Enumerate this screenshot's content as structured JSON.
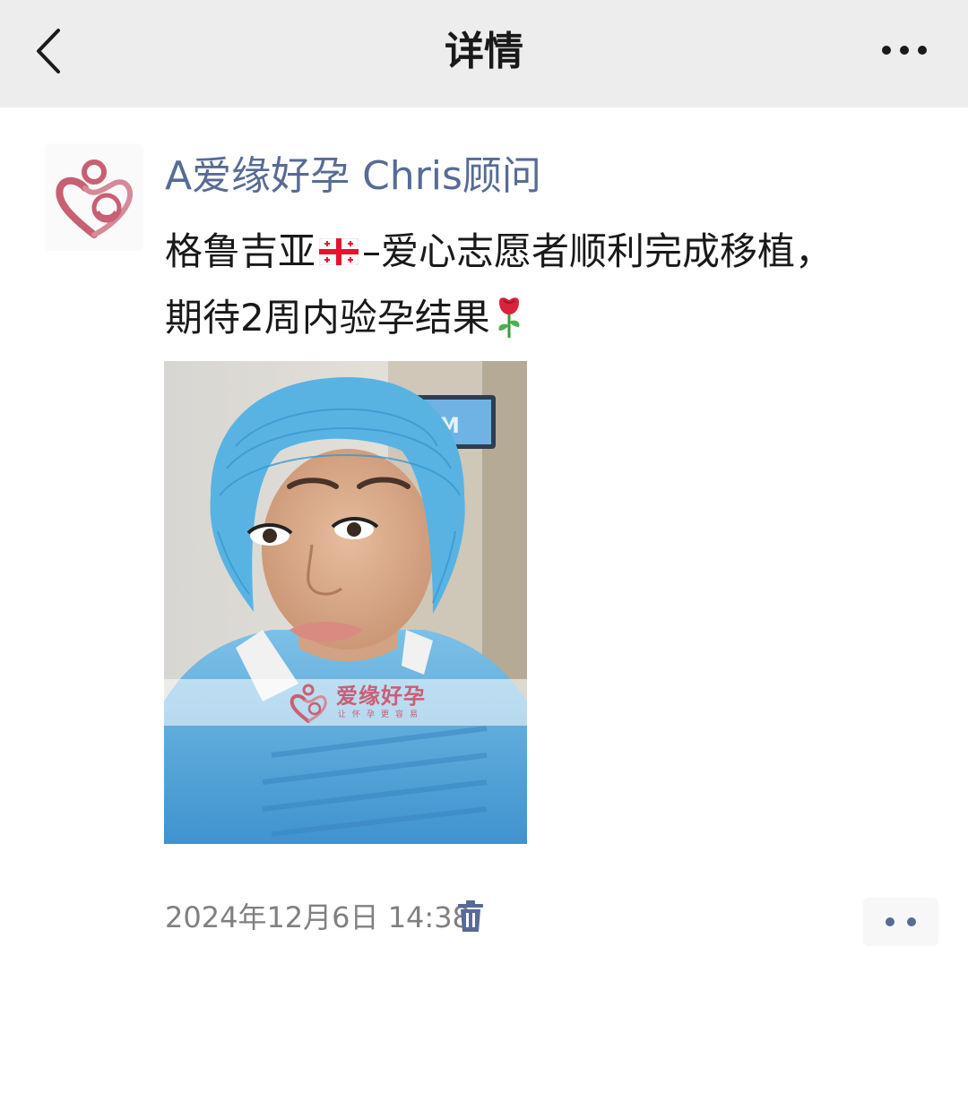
{
  "navbar": {
    "title": "详情",
    "back_icon": "chevron-left-icon",
    "more_icon": "more-dots-icon"
  },
  "post": {
    "author": "A爱缘好孕 Chris顾问",
    "text_part1": "格鲁吉亚",
    "text_part2": "–爱心志愿者顺利完成移植，",
    "text_part3": "期待2周内验孕结果",
    "flag_icon": "georgia-flag-icon",
    "rose_icon": "rose-icon",
    "image": {
      "watermark_title": "爱缘好孕",
      "watermark_subtitle": "让怀孕更容易",
      "background_screen_text": "M"
    },
    "timestamp": "2024年12月6日 14:38",
    "delete_icon": "trash-icon",
    "comment_icon": "two-dots-icon"
  },
  "colors": {
    "link": "#576b95",
    "navbar_bg": "#ededed",
    "brand_pink": "#c95f73"
  }
}
